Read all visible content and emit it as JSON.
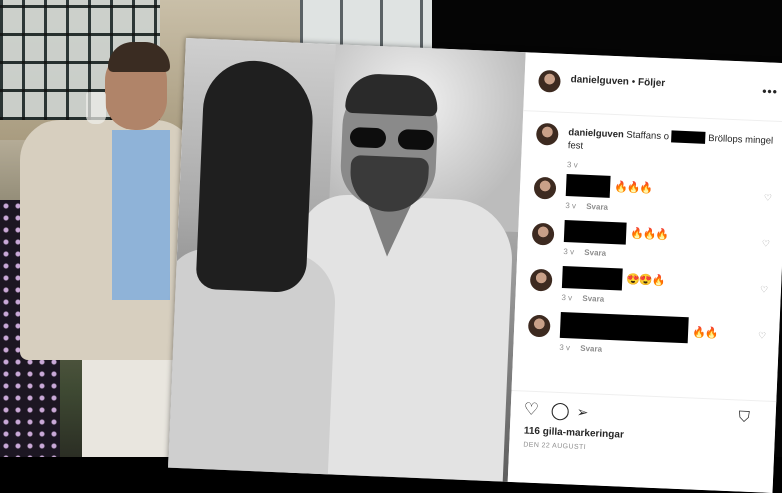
{
  "post": {
    "username": "danielguven",
    "separator": "•",
    "follow_label": "Följer",
    "more_icon": "more-icon",
    "caption": {
      "username": "danielguven",
      "text_before": "Staffans o",
      "text_after": "Bröllops mingel fest",
      "time": "3 v"
    },
    "comments": [
      {
        "emoji": "🔥🔥🔥",
        "time": "3 v",
        "reply": "Svara"
      },
      {
        "emoji": "🔥🔥🔥",
        "time": "3 v",
        "reply": "Svara"
      },
      {
        "emoji": "😍😍🔥",
        "time": "3 v",
        "reply": "Svara"
      },
      {
        "emoji": "🔥🔥",
        "time": "3 v",
        "reply": "Svara"
      }
    ],
    "likes": "116 gilla-markeringar",
    "date": "DEN 22 AUGUSTI"
  }
}
